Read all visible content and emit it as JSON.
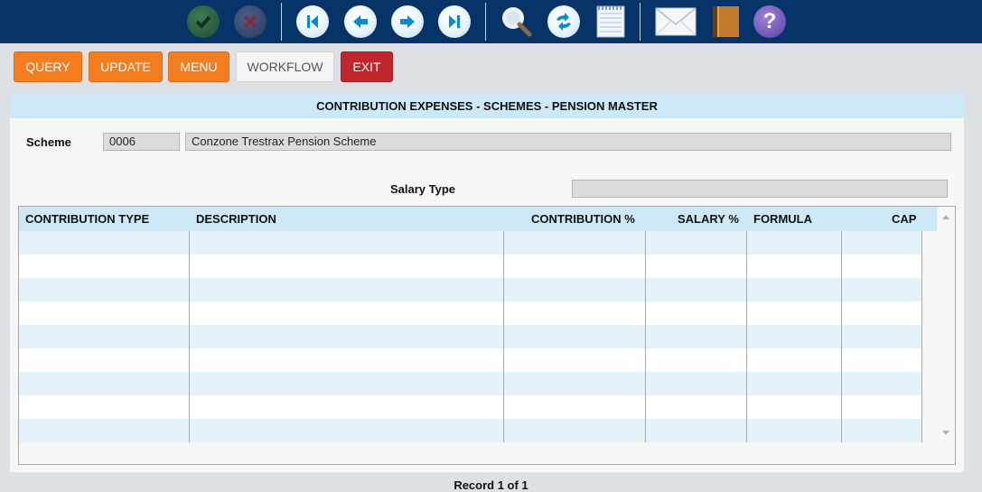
{
  "toolbar": {
    "icons": [
      "check-icon",
      "cancel-icon",
      "first-record-icon",
      "previous-record-icon",
      "next-record-icon",
      "last-record-icon",
      "search-icon",
      "refresh-icon",
      "notepad-icon",
      "mail-icon",
      "book-icon",
      "help-icon"
    ],
    "help_glyph": "?",
    "colors": {
      "bar": "#063468",
      "accent_blue": "#0a8ad0"
    }
  },
  "actions": {
    "query": "QUERY",
    "update": "UPDATE",
    "menu": "MENU",
    "workflow": "WORKFLOW",
    "exit": "EXIT"
  },
  "panel": {
    "title": "CONTRIBUTION EXPENSES - SCHEMES - PENSION MASTER",
    "scheme_label": "Scheme",
    "scheme_code": "0006",
    "scheme_name": "Conzone Trestrax Pension Scheme",
    "salary_type_label": "Salary Type",
    "salary_type_value": ""
  },
  "grid": {
    "columns": [
      "CONTRIBUTION TYPE",
      "DESCRIPTION",
      "CONTRIBUTION %",
      "SALARY %",
      "FORMULA",
      "CAP"
    ],
    "rows": []
  },
  "footer": {
    "record_text": "Record 1 of 1"
  }
}
